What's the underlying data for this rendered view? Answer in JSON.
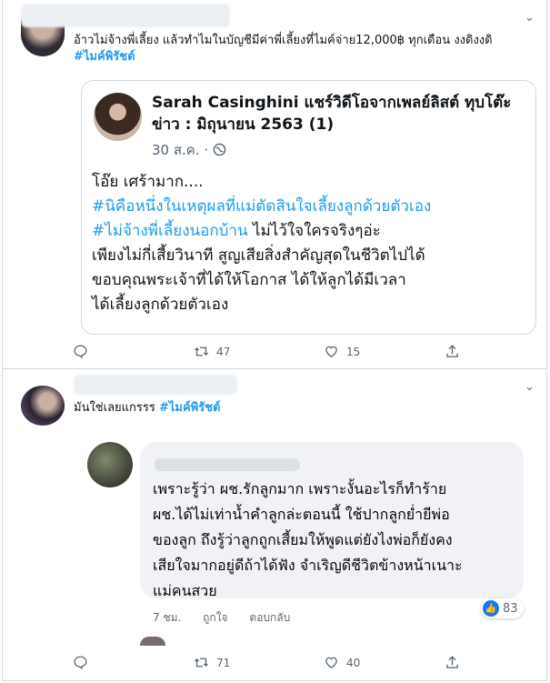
{
  "tweet1": {
    "text_prefix": "อ้าวไม่จ้างพี่เลี้ยง แล้วทำไมในบัญชีมีค่าพี่เลี้ยงที่ไมค์จ่าย12,000฿ ทุกเดือน งงดิงงดิ",
    "hashtag": "#ไมค์พิรัชต์",
    "card": {
      "name": "Sarah Casinghini แชร์วิดีโอจากเพลย์ลิสต์ ทุบโต๊ะข่าว : มิถุนายน 2563 (1)",
      "date": "30 ส.ค. ·",
      "line1": "โอ๊ย เศร้ามาก....",
      "line2": "#นิคือหนึ่งในเหตุผลที่แม่ตัดสินใจเลี้ยงลูกด้วยตัวเอง",
      "line3_tag": "#ไม่จ้างพี่เลี้ยงนอกบ้าน",
      "line3_rest": " ไม่ไว้ใจใครจริงๆอ่ะ",
      "line4": "เพียงไม่กี่เสี้ยวินาที สูญเสียสิ่งสำคัญสุดในชีวิตไปได้",
      "line5": "ขอบคุณพระเจ้าที่ได้ให้โอกาส ได้ให้ลูกได้มีเวลา",
      "line6": "ได้เลี้ยงลูกด้วยตัวเอง"
    },
    "retweets": "47",
    "likes": "15"
  },
  "tweet2": {
    "text_prefix": "มันใช่เลยแกรรร ",
    "hashtag": "#ไมค์พิรัชต์",
    "fb": {
      "lines": [
        "เพราะรู้ว่า ผช.รักลูกมาก เพราะงั้นอะไรก็ทำร้าย",
        "ผช.ได้ไม่เท่าน้ำคำลูกล่ะตอนนี้ ใช้ปากลูกย่ำยีพ่อ",
        "ของลูก ถึงรู้ว่าลูกถูกเสี้ยมให้พูดแต่ยังไงพ่อก็ยังคง",
        "เสียใจมากอยู่ดีถ้าได้ฟัง จำเริญดีชีวิตข้างหน้าเนาะ",
        "แม่คนสวย"
      ],
      "time": "7 ชม.",
      "like_label": "ถูกใจ",
      "reply_label": "ตอบกลับ",
      "reaction_count": "83"
    },
    "retweets": "71",
    "likes": "40"
  },
  "colors": {
    "link": "#1d9bf0",
    "border": "#cfd9de",
    "muted": "#536471"
  }
}
